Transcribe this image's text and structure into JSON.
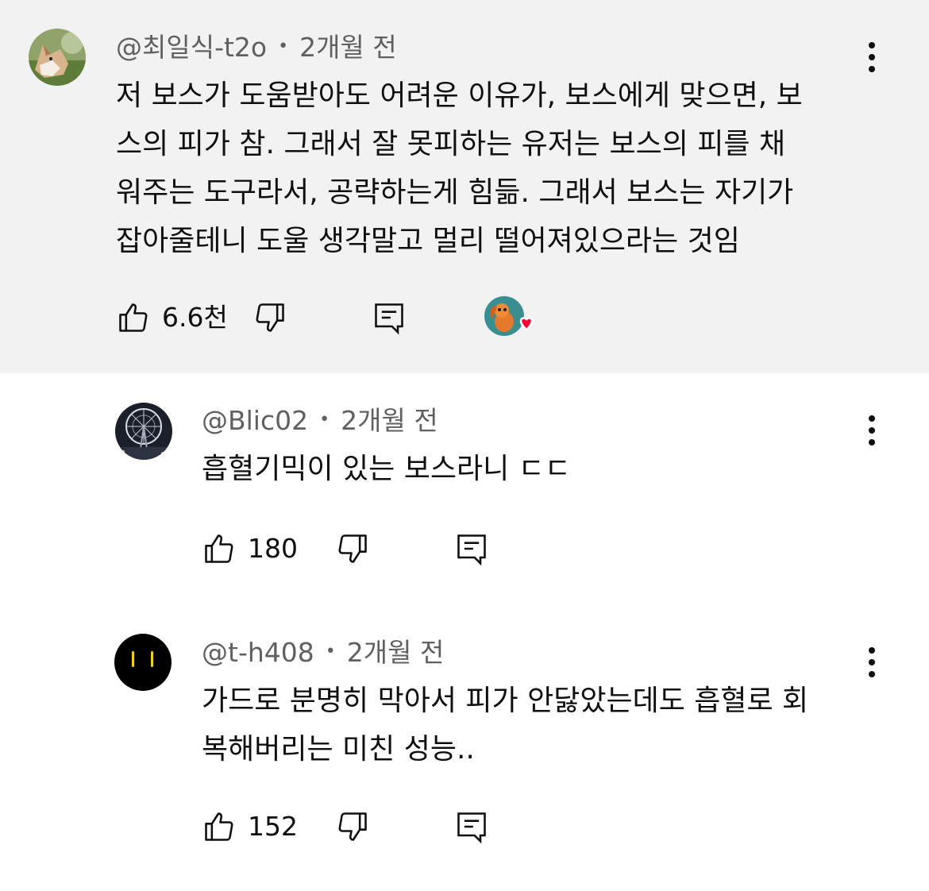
{
  "comments": [
    {
      "author": "@최일식-t2o",
      "separator": "•",
      "time": "2개월 전",
      "text": "저 보스가 도움받아도 어려운 이유가, 보스에게 맞으면, 보\n스의 피가 참. 그래서 잘 못피하는 유저는 보스의 피를 채\n워주는 도구라서, 공략하는게 힘듦. 그래서 보스는 자기가\n잡아줄테니 도울 생각말고 멀리 떨어져있으라는 것임",
      "likes": "6.6천",
      "avatar_icon": "fox-avatar",
      "creator_heart": true
    },
    {
      "author": "@Blic02",
      "separator": "•",
      "time": "2개월 전",
      "text": "흡혈기믹이 있는 보스라니 ㄷㄷ",
      "likes": "180",
      "avatar_icon": "ferris-wheel-avatar"
    },
    {
      "author": "@t-h408",
      "separator": "•",
      "time": "2개월 전",
      "text": "가드로 분명히 막아서 피가 안닳았는데도 흡혈로 회\n복해버리는 미친 성능..",
      "likes": "152",
      "avatar_icon": "black-face-avatar"
    }
  ],
  "colors": {
    "highlight_bg": "#f2f2f2",
    "meta_text": "#606060",
    "primary_text": "#0f0f0f",
    "heart": "#ff0033"
  }
}
